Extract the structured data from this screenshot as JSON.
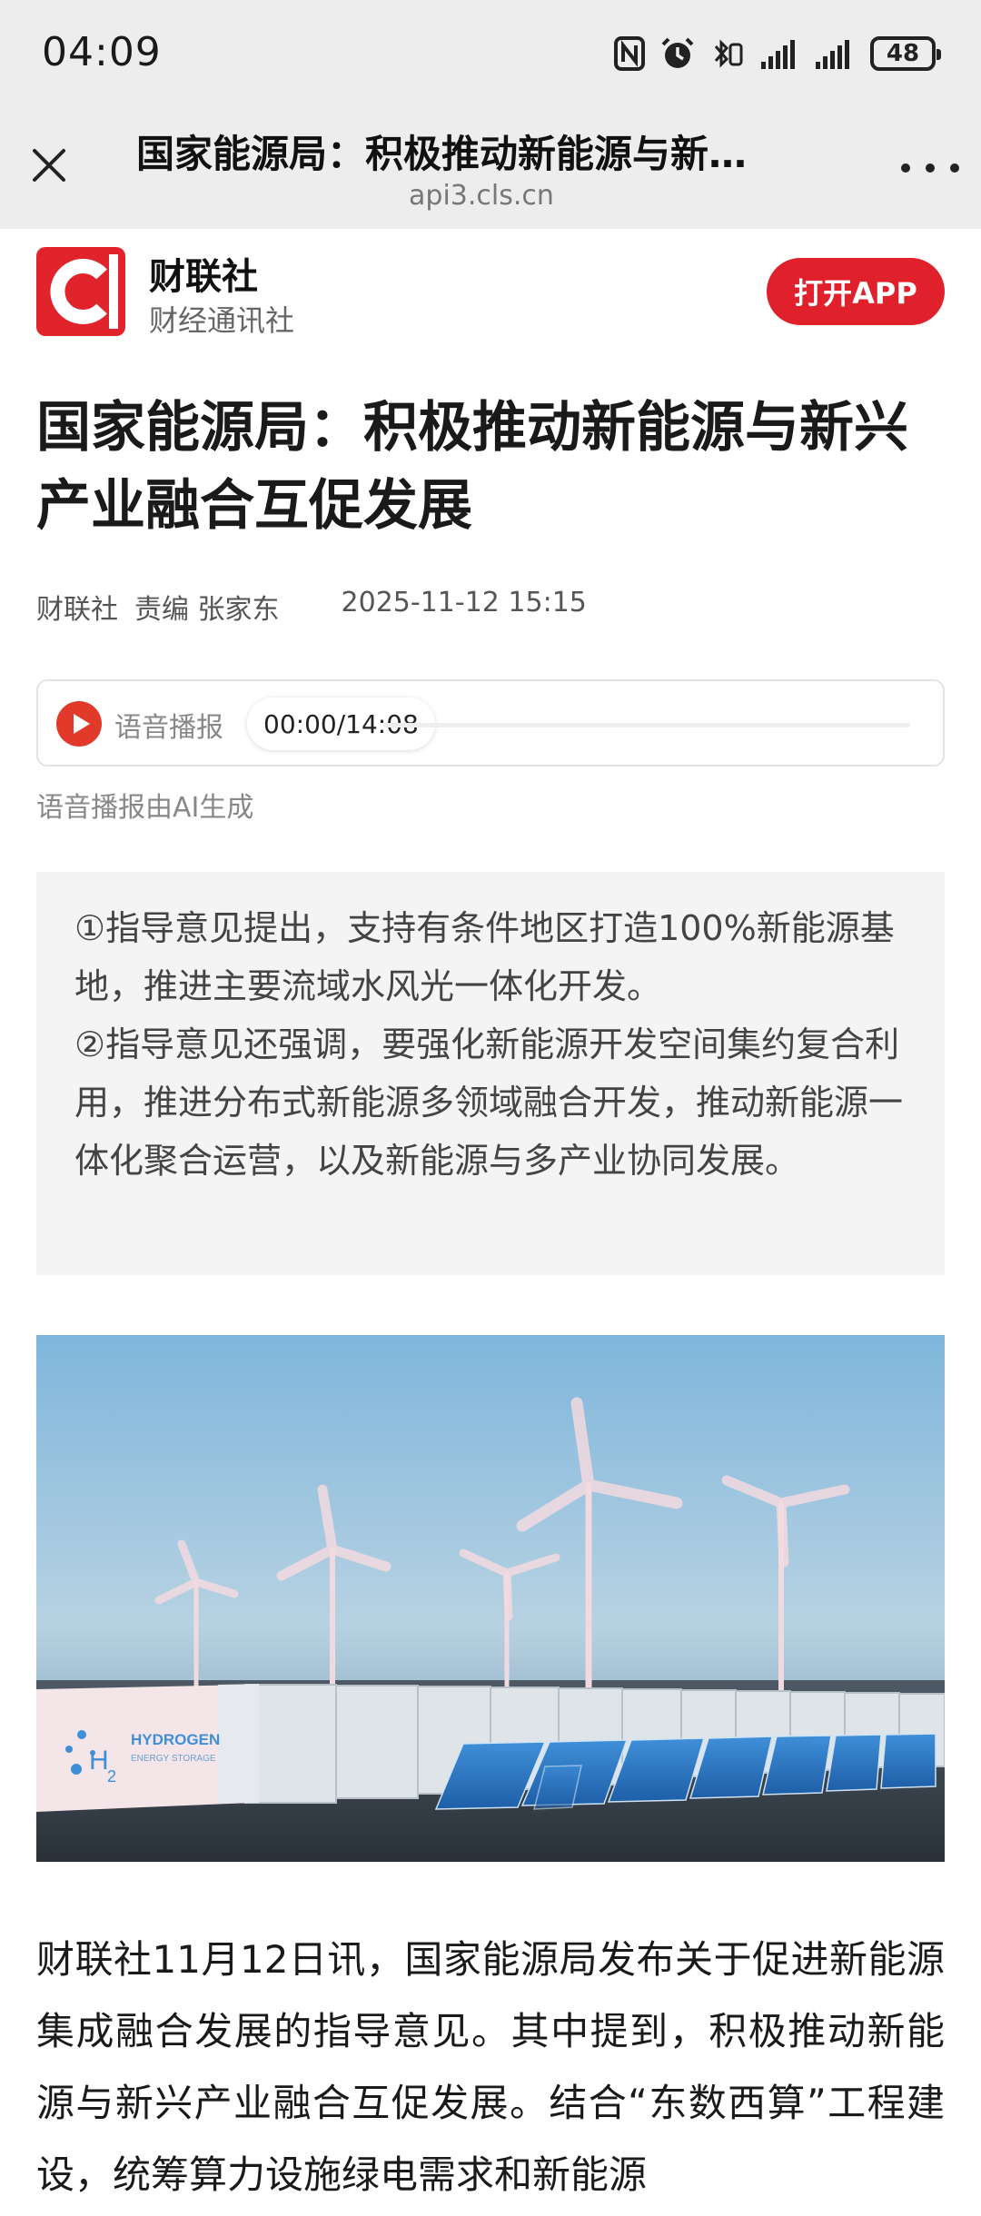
{
  "status_bar": {
    "time": "04:09",
    "battery": "48"
  },
  "browser": {
    "title": "国家能源局：积极推动新能源与新…",
    "url": "api3.cls.cn"
  },
  "publisher": {
    "logo_letter": "C",
    "name": "财联社",
    "subtitle": "财经通讯社",
    "open_app_label": "打开APP",
    "brand_color": "#e1232b"
  },
  "article": {
    "headline": "国家能源局：积极推动新能源与新兴产业融合互促发展",
    "source": "财联社",
    "editor": "责编 张家东",
    "date": "2025-11-12 15:15",
    "audio": {
      "label": "语音播报",
      "time": "00:00/14:08",
      "note": "语音播报由AI生成"
    },
    "summary": [
      "①指导意见提出，支持有条件地区打造100%新能源基地，推进主要流域水风光一体化开发。",
      "②指导意见还强调，要强化新能源开发空间集约复合利用，推进分布式新能源多领域融合开发，推动新能源一体化聚合运营，以及新能源与多产业协同发展。"
    ],
    "image": {
      "container_brand": "HYDROGEN",
      "container_sub": "ENERGY STORAGE",
      "h2_label": "H",
      "h2_sub": "2"
    },
    "body": "财联社11月12日讯，国家能源局发布关于促进新能源集成融合发展的指导意见。其中提到，积极推动新能源与新兴产业融合互促发展。结合“东数西算”工程建设，统筹算力设施绿电需求和新能源"
  }
}
